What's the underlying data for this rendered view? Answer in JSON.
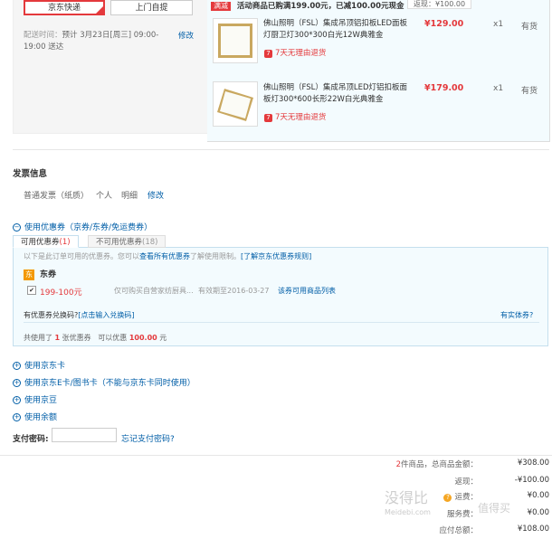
{
  "delivery": {
    "options": [
      "京东快递",
      "上门自提"
    ],
    "time_label": "配送时间：",
    "time_value": "预计 3月23日[周三] 09:00-19:00 送达",
    "edit": "修改"
  },
  "promo": {
    "tag": "满减",
    "text": "活动商品已购满199.00元，已减100.00元现金",
    "returned_label": "返现：",
    "returned_value": "¥100.00"
  },
  "products": [
    {
      "name": "佛山照明（FSL）集成吊顶铝扣板LED面板灯厨卫灯300*300白光12W典雅金",
      "price": "¥129.00",
      "qty": "x1",
      "stock": "有货",
      "return_icon": "7",
      "return": "7天无理由退货"
    },
    {
      "name": "佛山照明（FSL）集成吊顶LED灯铝扣板面板灯300*600长形22W白光典雅金",
      "price": "¥179.00",
      "qty": "x1",
      "stock": "有货",
      "return_icon": "7",
      "return": "7天无理由退货"
    }
  ],
  "invoice": {
    "title": "发票信息",
    "type": "普通发票（纸质）",
    "owner": "个人",
    "content": "明细",
    "edit": "修改"
  },
  "coupons": {
    "header": "使用优惠券（京券/东券/免运费券）",
    "tab_available": "可用优惠券",
    "tab_available_count": "(1)",
    "tab_unavailable": "不可用优惠券",
    "tab_unavailable_count": "(18)",
    "notice_prefix": "以下是此订单可用的优惠券。您可以",
    "notice_link1": "查看所有优惠券",
    "notice_mid": "了解使用限制。",
    "notice_link2": "[了解京东优惠券规则]",
    "group_icon": "东",
    "group_label": "东券",
    "coupon_amount": "199-100元",
    "coupon_desc": "仅可购买自营家纺厨具...",
    "coupon_expire": "有效期至2016-03-27",
    "coupon_link": "该券可用商品列表",
    "redeem_q": "有优惠券兑换码?",
    "redeem_link": "[点击输入兑换码]",
    "physical_link": "有实体券?",
    "used_prefix": "共使用了",
    "used_count": "1",
    "used_mid": "张优惠券",
    "save_prefix": "可以优惠",
    "save_amount": "100.00",
    "save_suffix": "元"
  },
  "other_payments": [
    "使用京东卡",
    "使用京东E卡/图书卡（不能与京东卡同时使用）",
    "使用京豆",
    "使用余额"
  ],
  "paypwd": {
    "label": "支付密码:",
    "placeholder": "",
    "forgot": "忘记支付密码?"
  },
  "summary": {
    "count": "2",
    "count_label": "件商品，总商品金额：",
    "goods_total": "¥308.00",
    "cashback_label": "返现：",
    "cashback": "-¥100.00",
    "freight_label": "运费：",
    "freight": "¥0.00",
    "service_label": "服务费：",
    "service": "¥0.00",
    "payable_label": "应付总额：",
    "payable": "¥108.00"
  },
  "watermark": {
    "brand": "没得比",
    "domain": "Meidebi.com",
    "tail": "值得买"
  }
}
